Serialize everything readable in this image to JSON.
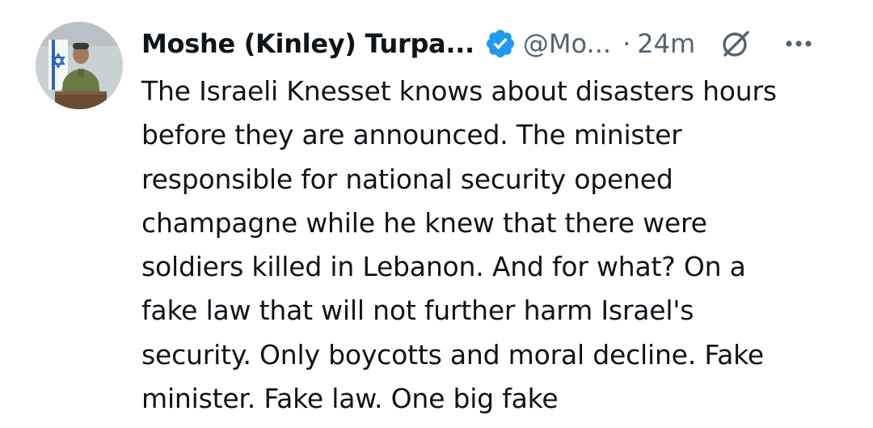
{
  "author": {
    "display_name": "Moshe (Kinley) Turpa...",
    "handle": "@Mo...",
    "separator": "·",
    "time": "24m",
    "verified_color": "#1d9bf0"
  },
  "tweet": {
    "text": "The Israeli Knesset knows about disasters hours\nbefore they are announced. The minister\nresponsible for national security opened\nchampagne while he knew that there were\nsoldiers killed in Lebanon. And for what? On a\nfake law that will not further harm Israel's\nsecurity. Only boycotts and moral decline. Fake\nminister. Fake law. One big fake"
  },
  "icons": {
    "verified": "verified-badge-icon",
    "grok": "grok-icon",
    "more": "more-options-icon"
  }
}
